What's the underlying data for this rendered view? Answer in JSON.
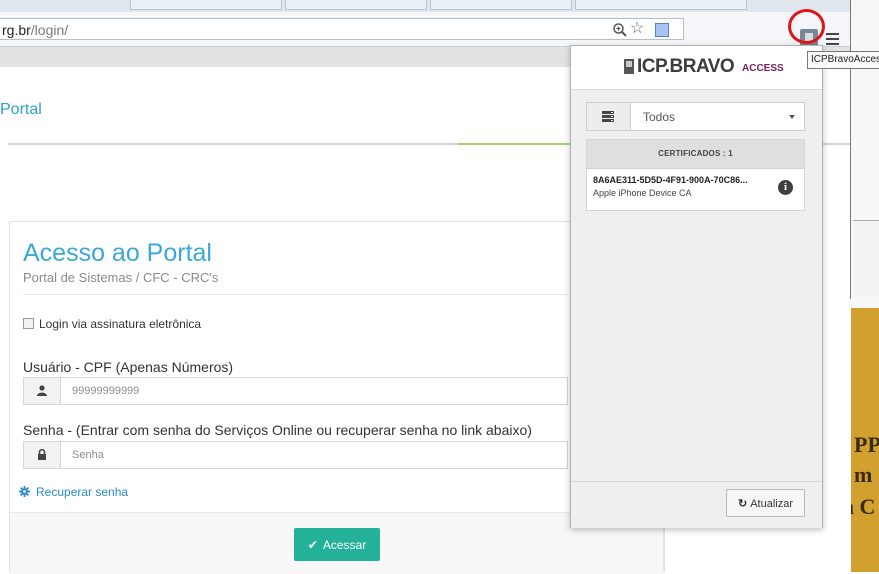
{
  "browser": {
    "url_main": "rg.br",
    "url_path": "/login/",
    "tooltip": "ICPBravoAccess"
  },
  "site": {
    "title_fragment": "Portal"
  },
  "login": {
    "title": "Acesso ao Portal",
    "subtitle": "Portal de Sistemas / CFC - CRC's",
    "checkbox_label": "Login via assinatura eletrônica",
    "user_label": "Usuário - CPF (Apenas Números)",
    "user_placeholder": "99999999999",
    "password_label": "Senha - (Entrar com senha do Serviços Online ou recuperar senha no link abaixo)",
    "password_placeholder": "Senha",
    "recover_link": "Recuperar senha",
    "submit_label": "Acessar",
    "accent_color": "#23b19a"
  },
  "extension": {
    "logo_text": "ICP.BRAVO",
    "logo_suffix": "ACCESS",
    "filter_value": "Todos",
    "certificates_header": "CERTIFICADOS : 1",
    "certificates": [
      {
        "id": "8A6AE311-5D5D-4F91-900A-70C86...",
        "issuer": "Apple iPhone Device CA"
      }
    ],
    "refresh_label": "Atualizar"
  },
  "background_page": {
    "fragments": [
      "PP",
      "m",
      "a C"
    ]
  },
  "icons": {
    "zoom": "zoom-icon",
    "star": "star-icon",
    "menu": "hamburger-menu-icon",
    "user": "user-icon",
    "lock": "lock-icon",
    "gear": "gear-icon",
    "check": "check-icon",
    "refresh": "refresh-icon",
    "info": "info-icon",
    "filter": "server-list-icon"
  }
}
